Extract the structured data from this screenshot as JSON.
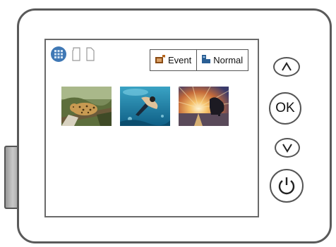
{
  "device": {
    "screen": {
      "status_icons": [
        "grid-view-icon",
        "sd-card-icon",
        "sd-card-icon"
      ],
      "tabs": [
        {
          "label": "Event",
          "icon": "event-folder-icon"
        },
        {
          "label": "Normal",
          "icon": "normal-folder-icon"
        }
      ],
      "thumbnails": [
        {
          "subject": "leopard-in-tree"
        },
        {
          "subject": "underwater-diver"
        },
        {
          "subject": "sunset-over-water"
        }
      ]
    },
    "buttons": {
      "up": {
        "icon": "chevron-up-icon"
      },
      "ok": {
        "label": "OK"
      },
      "down": {
        "icon": "chevron-down-icon"
      },
      "power": {
        "icon": "power-icon"
      }
    }
  },
  "colors": {
    "outline": "#5a5a5a",
    "grid_icon": "#3f78b5",
    "event_icon": "#b5651d",
    "normal_icon": "#2b5f94"
  }
}
